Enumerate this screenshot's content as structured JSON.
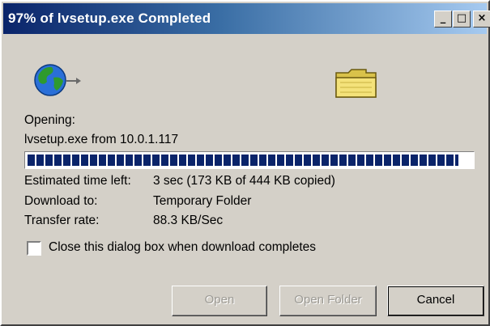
{
  "window": {
    "title": "97% of lvsetup.exe Completed"
  },
  "titlebar": {
    "minimize_label": "_",
    "maximize_label": "□",
    "close_label": "×"
  },
  "body": {
    "opening_label": "Opening:",
    "file_source": "lvsetup.exe from 10.0.1.117",
    "progress_percent": 97,
    "details": [
      {
        "label": "Estimated time left:",
        "value": "3 sec (173 KB of 444 KB copied)"
      },
      {
        "label": "Download to:",
        "value": "Temporary Folder"
      },
      {
        "label": "Transfer rate:",
        "value": "88.3 KB/Sec"
      }
    ],
    "close_checkbox_label": "Close this dialog box when download completes",
    "close_checkbox_checked": false
  },
  "buttons": {
    "open": "Open",
    "open_folder": "Open Folder",
    "cancel": "Cancel"
  },
  "icons": {
    "globe": "globe-icon",
    "folder": "folder-icon"
  },
  "colors": {
    "titlebar_start": "#0a246a",
    "titlebar_end": "#a6caf0",
    "progress_fill": "#0a246a",
    "dialog_bg": "#d4d0c8"
  }
}
